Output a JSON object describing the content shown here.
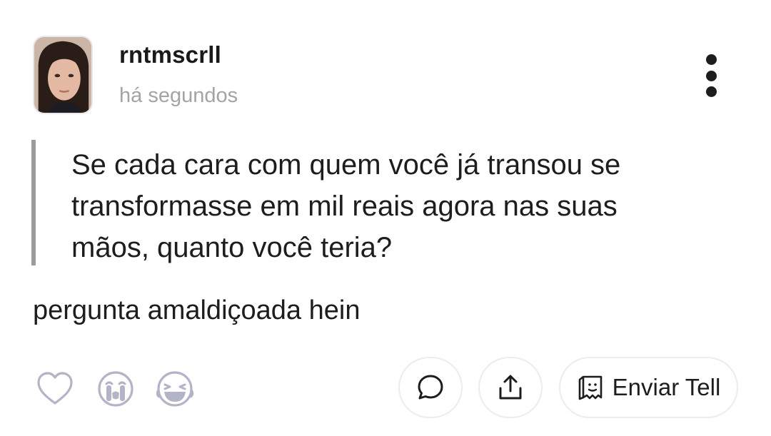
{
  "post": {
    "author": "rntmscrll",
    "timestamp": "há segundos",
    "question": "Se cada cara com quem você já transou se transformasse em mil reais agora nas suas mãos, quanto você teria?",
    "answer": "pergunta amaldiçoada hein"
  },
  "actions": {
    "reactions": [
      "heart-icon",
      "crying-face-icon",
      "laughing-face-icon"
    ],
    "comment_icon": "comment-bubble-icon",
    "share_icon": "share-upload-icon",
    "send_tell_icon": "tell-paper-icon",
    "send_tell_label": "Enviar Tell"
  },
  "colors": {
    "text": "#1d1d1f",
    "muted": "#a3a3a8",
    "quote_bar": "#9b9b9f",
    "reaction_icon": "#b4b4c8",
    "pill_border": "#ececf0"
  }
}
